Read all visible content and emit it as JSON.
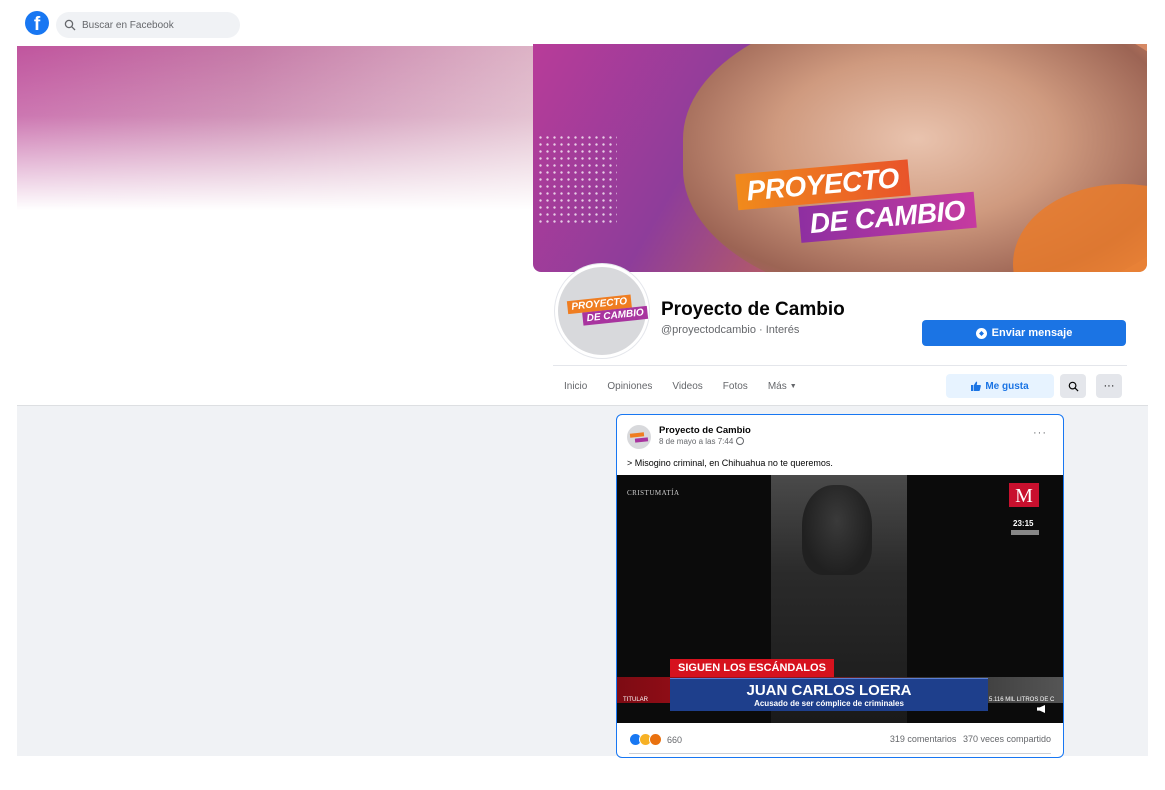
{
  "topbar": {
    "search_placeholder": "Buscar en Facebook"
  },
  "cover": {
    "logo_line1": "PROYECTO",
    "logo_line2": "DE CAMBIO"
  },
  "profile": {
    "logo_line1": "PROYECTO",
    "logo_line2": "DE CAMBIO",
    "name": "Proyecto de Cambio",
    "handle": "@proyectodcambio · Interés"
  },
  "actions": {
    "message_label": "Enviar mensaje",
    "like_label": "Me gusta",
    "more_symbol": "···"
  },
  "nav": {
    "items": [
      "Inicio",
      "Opiniones",
      "Videos",
      "Fotos",
      "Más"
    ]
  },
  "post": {
    "author": "Proyecto de Cambio",
    "time": "8 de mayo a las 7:44",
    "more": "···",
    "text": "> Misogino criminal, en Chihuahua no te queremos.",
    "video": {
      "watermark": "CRISTUMATÍA",
      "channel_logo": "M",
      "channel_time": "23:15",
      "headline_tag": "SIGUEN LOS ESCÁNDALOS",
      "headline_name": "JUAN CARLOS LOERA",
      "headline_sub": "Acusado de ser cómplice de criminales",
      "ticker_left": "TITULAR",
      "ticker_right": "5.116 MIL LITROS DE C"
    },
    "reactions_count": "660",
    "comments": "319 comentarios",
    "shares": "370 veces compartido"
  },
  "colors": {
    "facebook_blue": "#1877f2",
    "button_blue": "#1b74e4",
    "feed_bg": "#f0f2f5"
  }
}
